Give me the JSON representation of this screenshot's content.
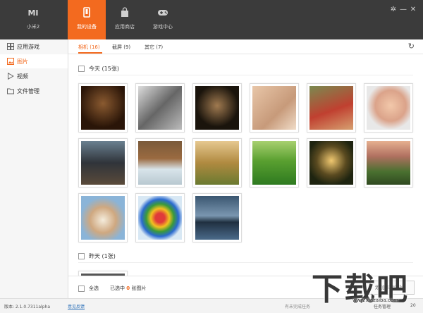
{
  "top_nav": {
    "brand_logo": "MI",
    "brand_label": "小米2",
    "tabs": [
      {
        "label": "我的设备",
        "icon": "phone-icon",
        "active": true
      },
      {
        "label": "应用商店",
        "icon": "shopping-bag-icon"
      },
      {
        "label": "游戏中心",
        "icon": "gamepad-icon"
      }
    ],
    "window_controls": [
      "settings-icon",
      "minimize-icon",
      "close-icon"
    ],
    "accent_color": "#f36a1f"
  },
  "sidebar": {
    "items": [
      {
        "label": "应用游戏",
        "icon": "apps-grid-icon"
      },
      {
        "label": "图片",
        "icon": "picture-icon",
        "active": true
      },
      {
        "label": "视频",
        "icon": "play-icon"
      },
      {
        "label": "文件管理",
        "icon": "folder-icon"
      }
    ]
  },
  "subtabs": [
    {
      "label": "相机 (16)",
      "active": true
    },
    {
      "label": "截屏 (9)"
    },
    {
      "label": "其它 (7)"
    }
  ],
  "groups": [
    {
      "label": "今天 (15张)"
    },
    {
      "label": "昨天 (1张)"
    }
  ],
  "bottom": {
    "select_all": "全选",
    "selected_prefix": "已选中",
    "selected_count": "0",
    "selected_suffix": "张图片",
    "add_button": "添加本地图片"
  },
  "status": {
    "version": "版本: 2.1.0.7311alpha",
    "feedback": "意见反馈",
    "tasks": "有未完成任务",
    "manager": "任务管理",
    "count": "20"
  },
  "watermark": {
    "text": "下载吧",
    "url": "www.xiazaiba.com"
  }
}
